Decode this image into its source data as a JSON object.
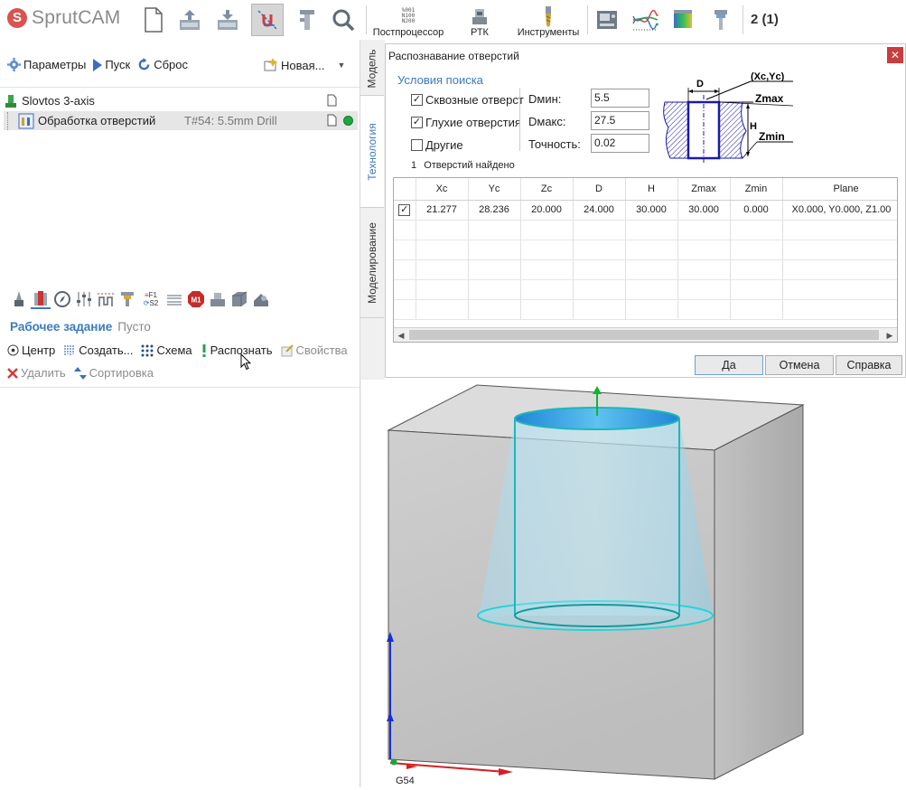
{
  "app": {
    "logo_text": "SprutCAM",
    "counter": "2 (1)"
  },
  "toolbar": {
    "postprocessor_label": "Постпроцессор",
    "postprocessor_icon_lines": [
      "%001",
      "N100",
      "N200"
    ],
    "rtk_label": "РТК",
    "tools_label": "Инструменты"
  },
  "left": {
    "params_label": "Параметры",
    "run_label": "Пуск",
    "reset_label": "Сброс",
    "new_label": "Новая...",
    "tree": [
      {
        "label": "Slovtos 3-axis"
      },
      {
        "label": "Обработка отверстий",
        "tool": "T#54: 5.5mm Drill"
      }
    ],
    "job_title": "Рабочее задание",
    "job_state": "Пусто",
    "actions1": [
      "Центр",
      "Создать...",
      "Схема",
      "Распознать",
      "Свойства"
    ],
    "actions2": [
      "Удалить",
      "Сортировка"
    ],
    "tool_strip_text": {
      "f1": "F1",
      "s2": "S2",
      "m1": "M1"
    }
  },
  "tabs": [
    "Модель",
    "Технология",
    "Моделирование"
  ],
  "dialog": {
    "title": "Распознавание отверстий",
    "group": "Условия поиска",
    "checks": [
      {
        "label": "Сквозные отверст",
        "checked": true
      },
      {
        "label": "Глухие отверстия",
        "checked": true
      },
      {
        "label": "Другие",
        "checked": false
      }
    ],
    "params": [
      {
        "label": "Dмин:",
        "value": "5.5"
      },
      {
        "label": "Dмакс:",
        "value": "27.5"
      },
      {
        "label": "Точность:",
        "value": "0.02"
      }
    ],
    "found_count": "1",
    "found_text": "Отверстий найдено",
    "diagram_labels": {
      "d": "D",
      "xcyc": "(Xc,Yc)",
      "zmax": "Zmax",
      "h": "H",
      "zmin": "Zmin"
    },
    "columns": [
      "Xc",
      "Yc",
      "Zc",
      "D",
      "H",
      "Zmax",
      "Zmin",
      "Plane"
    ],
    "rows": [
      {
        "checked": true,
        "cells": [
          "21.277",
          "28.236",
          "20.000",
          "24.000",
          "30.000",
          "30.000",
          "0.000",
          "X0.000, Y0.000, Z1.00"
        ]
      }
    ],
    "buttons": {
      "ok": "Да",
      "cancel": "Отмена",
      "help": "Справка"
    }
  },
  "viewport": {
    "cs_label": "G54"
  },
  "colors": {
    "accent": "#3a7bbf",
    "hole_fill": "#2fa3df",
    "outline": "#1fc6c9"
  }
}
